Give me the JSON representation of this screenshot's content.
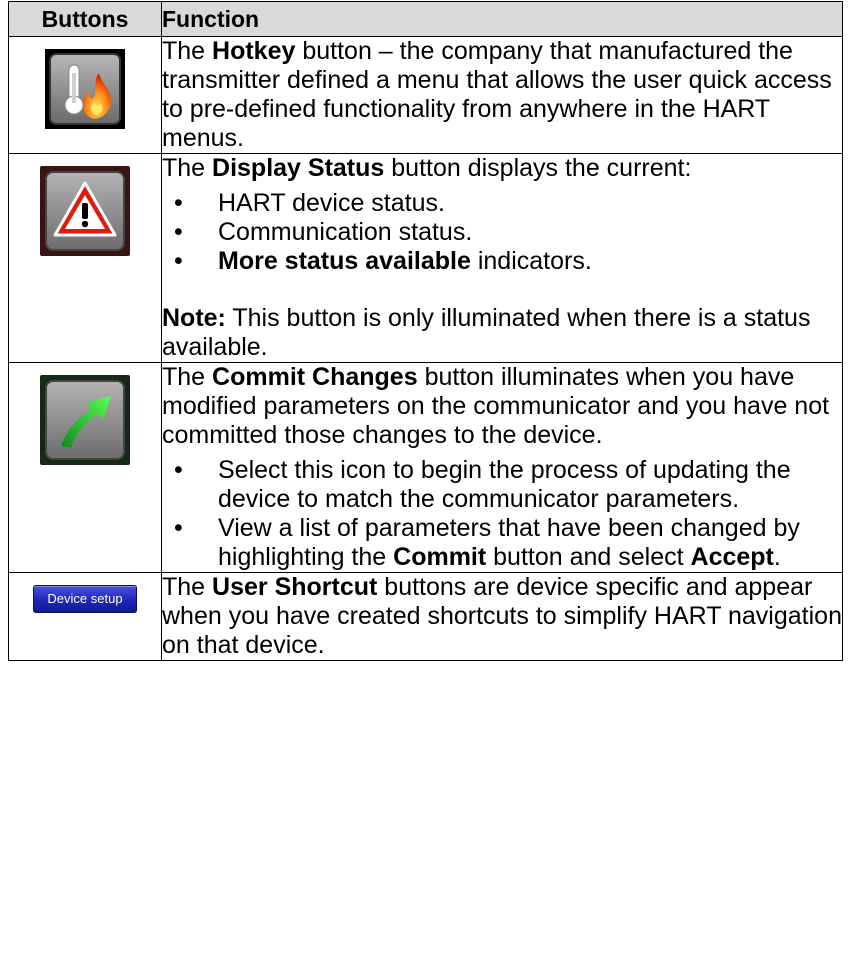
{
  "headers": {
    "buttons": "Buttons",
    "function": "Function"
  },
  "rows": [
    {
      "icon": "hotkey-thermometer-flame-icon",
      "parts": [
        {
          "t": "The ",
          "b": false
        },
        {
          "t": "Hotkey",
          "b": true
        },
        {
          "t": " button – the company that manufactured the transmitter defined a menu that allows the user quick access to pre-defined functionality from anywhere in the HART menus.",
          "b": false
        }
      ]
    },
    {
      "icon": "warning-triangle-icon",
      "intro": [
        {
          "t": "The ",
          "b": false
        },
        {
          "t": "Display Status",
          "b": true
        },
        {
          "t": " button displays the current:",
          "b": false
        }
      ],
      "bullets": [
        {
          "a": "HART device status.",
          "bold": "",
          "c": ""
        },
        {
          "a": "Communication status.",
          "bold": "",
          "c": ""
        },
        {
          "a": "",
          "bold": "More status available",
          "c": " indicators."
        }
      ],
      "note": {
        "label": "Note:",
        "text": " This button is only illuminated when there is a status available."
      }
    },
    {
      "icon": "commit-arrow-icon",
      "intro": [
        {
          "t": "The ",
          "b": false
        },
        {
          "t": "Commit Changes",
          "b": true
        },
        {
          "t": " button illuminates when you have modified parameters on the communicator and you have not committed those changes to the device.",
          "b": false
        }
      ],
      "bullets": [
        {
          "a": "Select this icon to begin the process of updating the device to match the communicator parameters.",
          "b1": "",
          "m": "",
          "b2": "",
          "e": ""
        },
        {
          "a": "View a list of parameters that have been changed by highlighting the ",
          "b1": "Commit",
          "m": " button and select ",
          "b2": "Accept",
          "e": "."
        }
      ]
    },
    {
      "icon": "device-setup-button",
      "button_label": "Device setup",
      "parts": [
        {
          "t": "The ",
          "b": false
        },
        {
          "t": "User Shortcut",
          "b": true
        },
        {
          "t": " buttons are device specific and appear when you have created shortcuts to simplify HART navigation on that device.",
          "b": false
        }
      ]
    }
  ]
}
